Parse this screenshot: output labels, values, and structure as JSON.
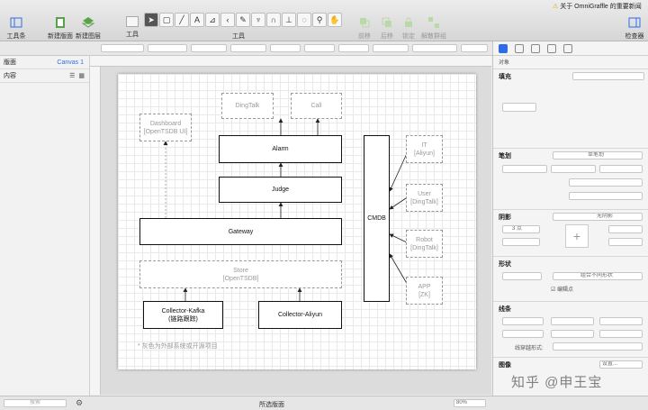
{
  "toolbar": {
    "toolbox": "工具条",
    "new_canvas": "新建版面",
    "new_layer": "新建图层",
    "tools_left": "工具",
    "tools_center": "工具",
    "front": "前移",
    "back": "后移",
    "lock": "锁定",
    "ungroup": "解散群组",
    "inspectors": "检查器",
    "news": "关于 OmniGraffle 的重要新闻"
  },
  "sidebar": {
    "canvas_label": "版面",
    "canvas_value": "Canvas 1",
    "content_label": "内容",
    "search_placeholder": "搜索"
  },
  "diagram": {
    "dingtalk": "DingTalk",
    "call": "Call",
    "dashboard": "Dashboard\n[OpenTSDB UI]",
    "alarm": "Alarm",
    "judge": "Judge",
    "gateway": "Gateway",
    "store": "Store\n[OpenTSDB]",
    "collector_kafka": "Collector-Kafka\n(链路跟踪)",
    "collector_aliyun": "Collector-Aliyun",
    "cmdb": "CMDB",
    "it": "IT\n[Aliyun]",
    "user": "User\n[DingTalk]",
    "robot": "Robot\n[DingTalk]",
    "app": "APP\n[ZK]",
    "note": "* 灰色为外部系统或开源项目"
  },
  "status": {
    "selection": "所选版面",
    "zoom": "80%"
  },
  "inspector": {
    "object": "对象",
    "fill": "填充",
    "stroke": "笔划",
    "stroke_type": "单笔划",
    "shadow": "阴影",
    "shadow_type": "无阴影",
    "shadow_size": "3 点",
    "shape": "形状",
    "shape_combine": "组合不同形状",
    "edit_points": "编辑点",
    "lines": "线条",
    "line_style": "线穿越形式:",
    "image": "图像",
    "image_settings": "设置..."
  },
  "watermark": "知乎 @申王宝"
}
